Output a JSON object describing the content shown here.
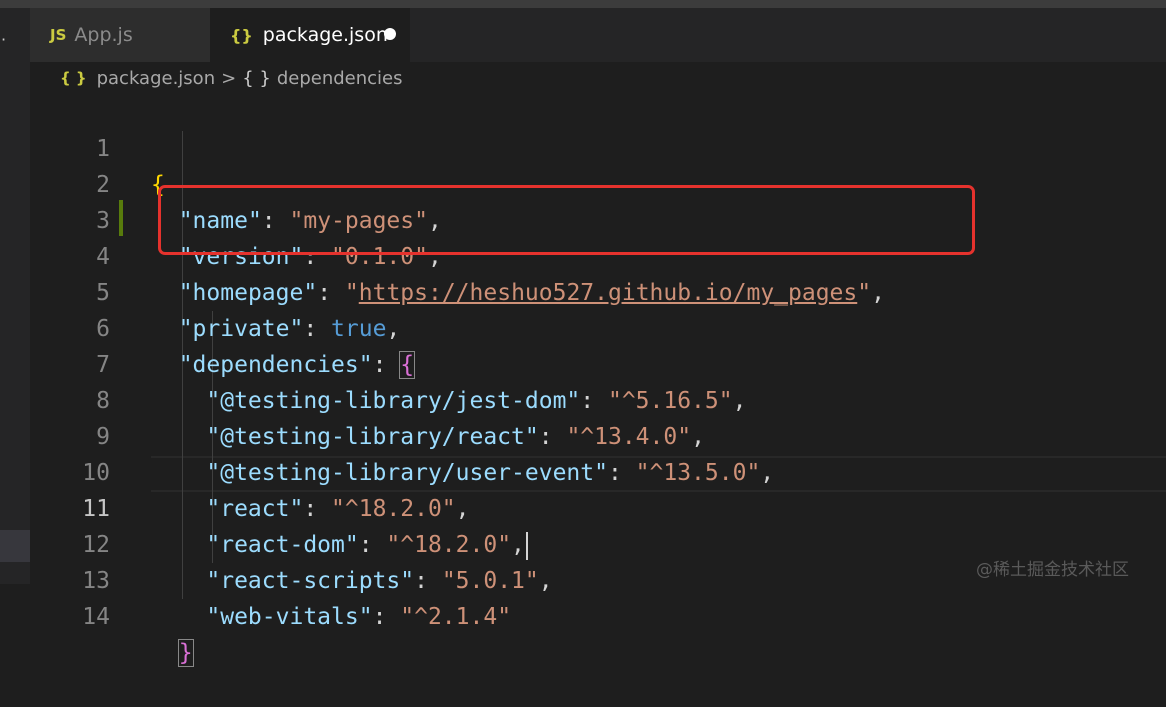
{
  "tabs": [
    {
      "icon": "JS",
      "label": "App.js"
    },
    {
      "icon": "{}",
      "label": "package.json",
      "modified": true
    }
  ],
  "breadcrumb": {
    "file_icon": "{ }",
    "file": "package.json",
    "separator": ">",
    "symbol_icon": "{ }",
    "symbol": "dependencies"
  },
  "lines": [
    {
      "num": "1"
    },
    {
      "num": "2"
    },
    {
      "num": "3"
    },
    {
      "num": "4"
    },
    {
      "num": "5"
    },
    {
      "num": "6"
    },
    {
      "num": "7"
    },
    {
      "num": "8"
    },
    {
      "num": "9"
    },
    {
      "num": "10"
    },
    {
      "num": "11"
    },
    {
      "num": "12"
    },
    {
      "num": "13"
    },
    {
      "num": "14"
    }
  ],
  "code": {
    "open_brace": "{",
    "name_key": "\"name\"",
    "name_val": "\"my-pages\"",
    "version_key": "\"version\"",
    "version_val": "\"0.1.0\"",
    "homepage_key": "\"homepage\"",
    "homepage_url": "https://heshuo527.github.io/my_pages",
    "private_key": "\"private\"",
    "private_val": "true",
    "deps_key": "\"dependencies\"",
    "deps_open": "{",
    "deps": [
      {
        "key": "\"@testing-library/jest-dom\"",
        "val": "\"^5.16.5\""
      },
      {
        "key": "\"@testing-library/react\"",
        "val": "\"^13.4.0\""
      },
      {
        "key": "\"@testing-library/user-event\"",
        "val": "\"^13.5.0\""
      },
      {
        "key": "\"react\"",
        "val": "\"^18.2.0\""
      },
      {
        "key": "\"react-dom\"",
        "val": "\"^18.2.0\""
      },
      {
        "key": "\"react-scripts\"",
        "val": "\"5.0.1\""
      },
      {
        "key": "\"web-vitals\"",
        "val": "\"^2.1.4\""
      }
    ],
    "deps_close": "}"
  },
  "watermark": "@稀土掘金技术社区",
  "colors": {
    "annotation_box": "#e5322d",
    "key": "#9cdcfe",
    "string": "#ce9178",
    "keyword": "#569cd6",
    "bracket_1": "#ffd700",
    "bracket_2": "#da70d6"
  }
}
